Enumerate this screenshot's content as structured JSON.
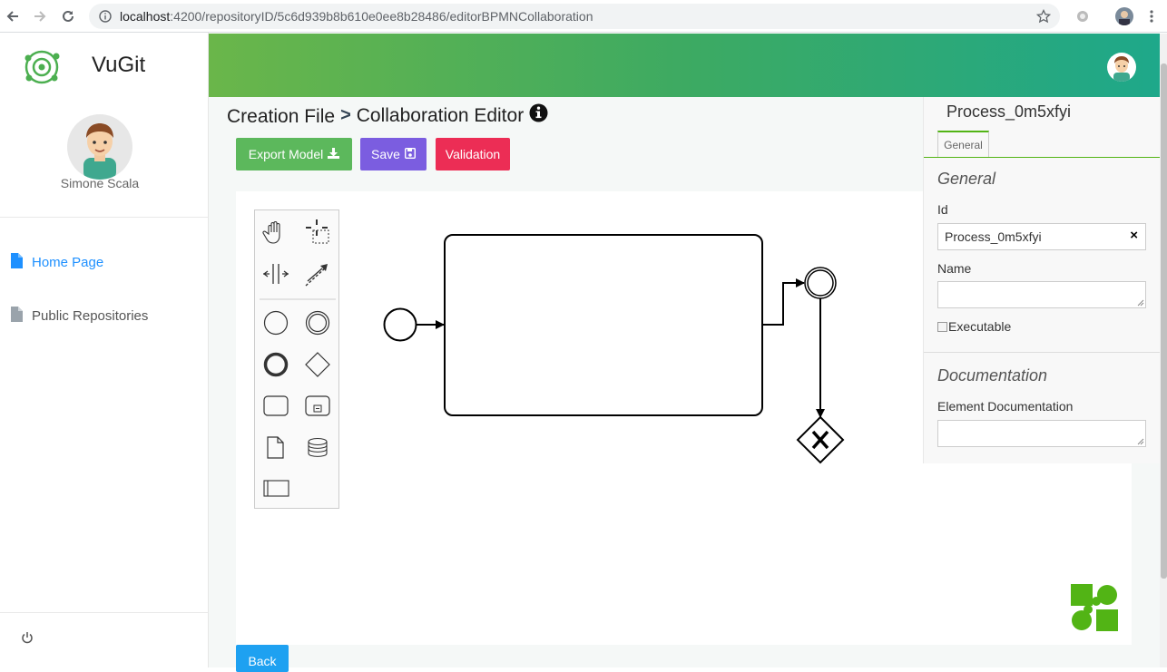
{
  "browser": {
    "url_host": "localhost",
    "url_rest": ":4200/repositoryID/5c6d939b8b610e0ee8b28486/editorBPMNCollaboration"
  },
  "sidebar": {
    "app_title": "VuGit",
    "user_name": "Simone Scala",
    "items": [
      {
        "label": "Home Page",
        "icon": "file-icon"
      },
      {
        "label": "Public Repositories",
        "icon": "file-icon"
      }
    ],
    "power_icon": "power-icon"
  },
  "main": {
    "breadcrumb_parent": "Creation File",
    "breadcrumb_separator": ">",
    "breadcrumb_current": "Collaboration Editor",
    "buttons": {
      "export": "Export Model",
      "save": "Save",
      "validation": "Validation",
      "back": "Back"
    },
    "colors": {
      "export": "#5cb85c",
      "save": "#7b5de0",
      "validation": "#ec2d55",
      "back": "#1ea1f1"
    }
  },
  "properties": {
    "title": "Process_0m5xfyi",
    "tab": "General",
    "general_heading": "General",
    "id_label": "Id",
    "id_value": "Process_0m5xfyi",
    "clear_glyph": "×",
    "name_label": "Name",
    "executable_label": "Executable",
    "documentation_heading": "Documentation",
    "element_documentation_label": "Element Documentation"
  }
}
